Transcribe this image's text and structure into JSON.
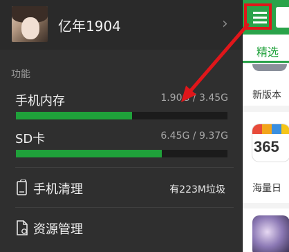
{
  "drawer": {
    "profile": {
      "username": "亿年1904",
      "avatar_icon": "user-avatar",
      "chevron_icon": "chevron-right-icon"
    },
    "section_label": "功能",
    "storage": [
      {
        "name": "手机内存",
        "value": "1.90G / 3.45G",
        "fraction": 0.55
      },
      {
        "name": "SD卡",
        "value": "6.45G / 9.37G",
        "fraction": 0.69
      }
    ],
    "tools": [
      {
        "label": "手机清理",
        "extra": "有223M垃圾",
        "icon": "phone-clean-icon"
      },
      {
        "label": "资源管理",
        "extra": "",
        "icon": "file-manager-icon"
      }
    ]
  },
  "main": {
    "menu_icon": "list-menu-icon",
    "tab_selected": "精选",
    "cards": [
      {
        "title": "新版本"
      },
      {
        "title": "海量日",
        "icon_text": "365"
      }
    ]
  },
  "colors": {
    "accent": "#2aa34a",
    "bar": "#1fa13a",
    "highlight": "#e0161a",
    "drawer_bg": "#2f2f2f"
  }
}
